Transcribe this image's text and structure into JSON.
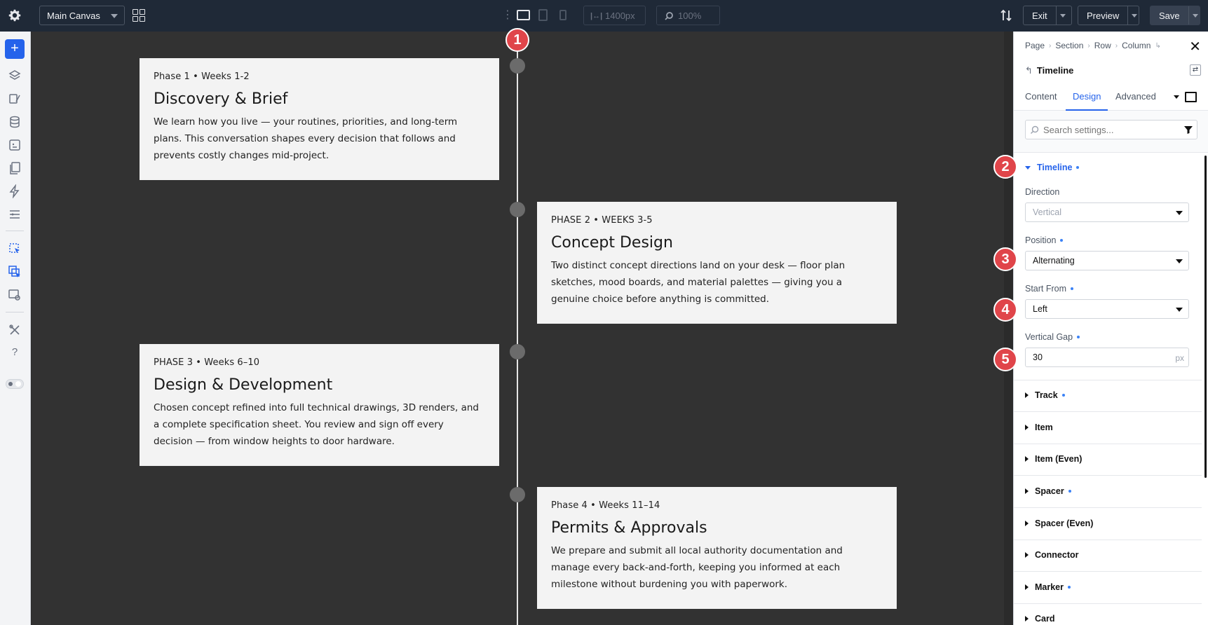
{
  "topbar": {
    "canvas_select": "Main Canvas",
    "width_value": "1400px",
    "zoom_value": "100%",
    "exit_label": "Exit",
    "preview_label": "Preview",
    "save_label": "Save"
  },
  "canvas": {
    "cards": [
      {
        "meta": "Phase 1 • Weeks 1-2",
        "title": "Discovery & Brief",
        "desc": "We learn how you live — your routines, priorities, and long-term plans. This conversation shapes every decision that follows and prevents costly changes mid-project."
      },
      {
        "meta": "PHASE 2 • WEEKS 3-5",
        "title": "Concept Design",
        "desc": "Two distinct concept directions land on your desk — floor plan sketches, mood boards, and material palettes — giving you a genuine choice before anything is committed."
      },
      {
        "meta": "PHASE 3 • Weeks 6–10",
        "title": "Design & Development",
        "desc": "Chosen concept refined into full technical drawings, 3D renders, and a complete specification sheet. You review and sign off every decision — from window heights to door hardware."
      },
      {
        "meta": "Phase 4 • Weeks 11–14",
        "title": "Permits & Approvals",
        "desc": "We prepare and submit all local authority documentation and manage every back-and-forth, keeping you informed at each milestone without burdening you with paperwork."
      }
    ]
  },
  "badges": [
    "1",
    "2",
    "3",
    "4",
    "5"
  ],
  "panel": {
    "breadcrumb": [
      "Page",
      "Section",
      "Row",
      "Column"
    ],
    "module_title": "Timeline",
    "tabs": [
      "Content",
      "Design",
      "Advanced"
    ],
    "search_placeholder": "Search settings...",
    "open_section": "Timeline",
    "fields": {
      "direction_label": "Direction",
      "direction_value": "Vertical",
      "position_label": "Position",
      "position_value": "Alternating",
      "start_from_label": "Start From",
      "start_from_value": "Left",
      "vertical_gap_label": "Vertical Gap",
      "vertical_gap_value": "30",
      "vertical_gap_unit": "px"
    },
    "sections": [
      "Track",
      "Item",
      "Item (Even)",
      "Spacer",
      "Spacer (Even)",
      "Connector",
      "Marker",
      "Card"
    ]
  },
  "colors": {
    "accent": "#2563eb",
    "badge": "#e0454a",
    "topbar": "#1f2937"
  }
}
